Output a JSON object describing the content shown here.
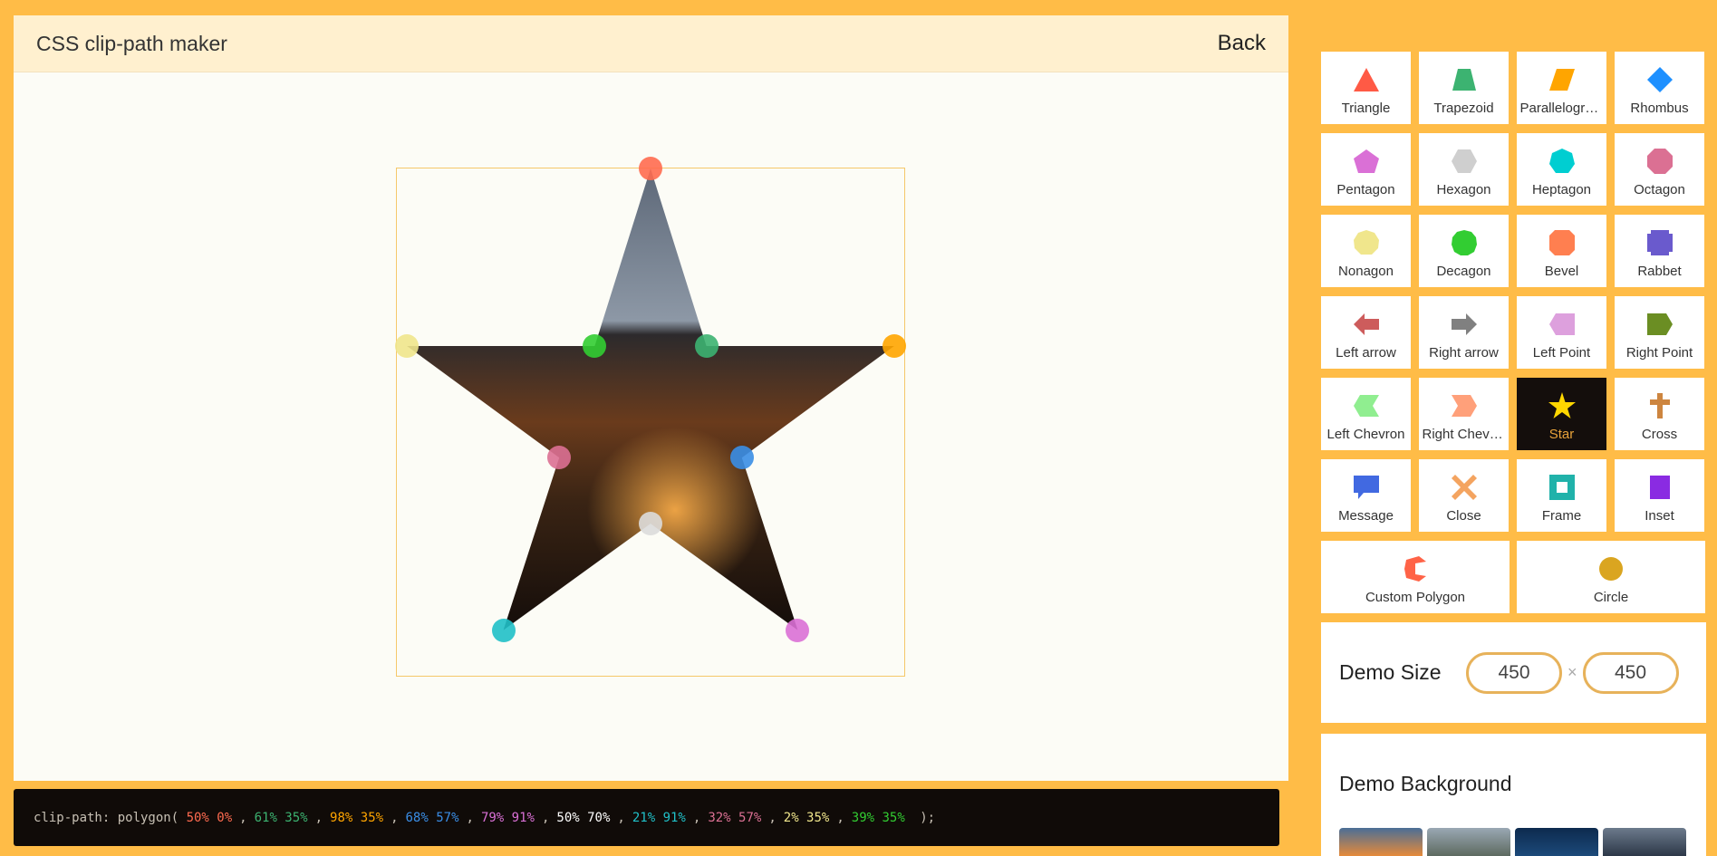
{
  "header": {
    "title": "CSS clip-path maker",
    "back_label": "Back"
  },
  "code": {
    "prefix": "clip-path: ",
    "fn_open": "polygon( ",
    "fn_close": " );",
    "points": [
      {
        "text": "50% 0%",
        "color": "#ff6b50"
      },
      {
        "text": "61% 35%",
        "color": "#3cb371"
      },
      {
        "text": "98% 35%",
        "color": "#ffa500"
      },
      {
        "text": "68% 57%",
        "color": "#3a8ee6"
      },
      {
        "text": "79% 91%",
        "color": "#da70d6"
      },
      {
        "text": "50% 70%",
        "color": "#ffffff"
      },
      {
        "text": "21% 91%",
        "color": "#20c0c8"
      },
      {
        "text": "32% 57%",
        "color": "#db7093"
      },
      {
        "text": "2% 35%",
        "color": "#f0e68c"
      },
      {
        "text": "39% 35%",
        "color": "#32cd32"
      }
    ],
    "separator": ","
  },
  "shapes": [
    {
      "label": "Triangle",
      "icon": "triangle-icon",
      "color": "#ff5a45"
    },
    {
      "label": "Trapezoid",
      "icon": "trapezoid-icon",
      "color": "#3cb371"
    },
    {
      "label": "Parallelogram",
      "icon": "parallelogram-icon",
      "color": "#ffa500"
    },
    {
      "label": "Rhombus",
      "icon": "rhombus-icon",
      "color": "#1e90ff"
    },
    {
      "label": "Pentagon",
      "icon": "pentagon-icon",
      "color": "#da70d6"
    },
    {
      "label": "Hexagon",
      "icon": "hexagon-icon",
      "color": "#cfcfcf"
    },
    {
      "label": "Heptagon",
      "icon": "heptagon-icon",
      "color": "#00ced1"
    },
    {
      "label": "Octagon",
      "icon": "octagon-icon",
      "color": "#db7093"
    },
    {
      "label": "Nonagon",
      "icon": "nonagon-icon",
      "color": "#f0e68c"
    },
    {
      "label": "Decagon",
      "icon": "decagon-icon",
      "color": "#32cd32"
    },
    {
      "label": "Bevel",
      "icon": "bevel-icon",
      "color": "#ff7f50"
    },
    {
      "label": "Rabbet",
      "icon": "rabbet-icon",
      "color": "#6a5acd"
    },
    {
      "label": "Left arrow",
      "icon": "left-arrow-icon",
      "color": "#cd5c5c"
    },
    {
      "label": "Right arrow",
      "icon": "right-arrow-icon",
      "color": "#808080"
    },
    {
      "label": "Left Point",
      "icon": "left-point-icon",
      "color": "#dda0dd"
    },
    {
      "label": "Right Point",
      "icon": "right-point-icon",
      "color": "#6b8e23"
    },
    {
      "label": "Left Chevron",
      "icon": "left-chevron-icon",
      "color": "#90ee90"
    },
    {
      "label": "Right Chevron",
      "icon": "right-chevron-icon",
      "color": "#ffa07a"
    },
    {
      "label": "Star",
      "icon": "star-icon",
      "color": "#ffd700",
      "active": true
    },
    {
      "label": "Cross",
      "icon": "cross-icon",
      "color": "#cd853f"
    },
    {
      "label": "Message",
      "icon": "message-icon",
      "color": "#4169e1"
    },
    {
      "label": "Close",
      "icon": "close-icon",
      "color": "#f4a460"
    },
    {
      "label": "Frame",
      "icon": "frame-icon",
      "color": "#20b2aa"
    },
    {
      "label": "Inset",
      "icon": "inset-icon",
      "color": "#8a2be2"
    },
    {
      "label": "Custom Polygon",
      "icon": "custom-polygon-icon",
      "color": "#ff6347",
      "wide": true
    },
    {
      "label": "Circle",
      "icon": "circle-icon",
      "color": "#daa520",
      "wide": true
    }
  ],
  "demo_size": {
    "label": "Demo Size",
    "width": "450",
    "height": "450",
    "times": "×"
  },
  "demo_background": {
    "label": "Demo Background"
  }
}
